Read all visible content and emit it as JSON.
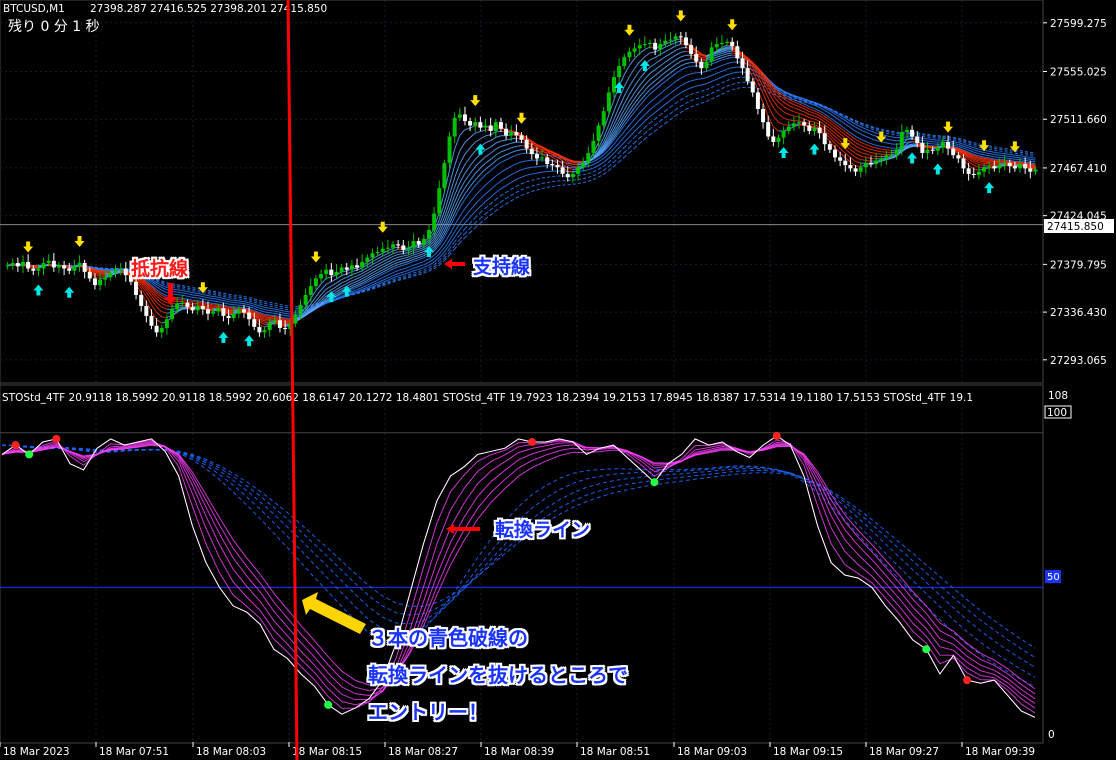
{
  "header": {
    "symbol": "BTCUSD,M1",
    "ohlc": "27398.287 27416.525 27398.201 27415.850",
    "countdown": "残り 0 分 1 秒"
  },
  "indicator": {
    "label": "STOStd_4TF 20.9118 18.5992 20.9118 18.5992 20.6062 18.6147 20.1272 18.4801  STOStd_4TF 19.7923 18.2394 19.2153 17.8945 18.8387 17.5314 19.1180 17.5153  STOStd_4TF 19.1",
    "max_label": "108",
    "top_label": "100",
    "mid_label": "50",
    "bottom_label": "0"
  },
  "annotations": {
    "resistance": "抵抗線",
    "support": "支持線",
    "transition": "転換ライン",
    "entry_line1": "３本の青色破線の",
    "entry_line2": "転換ラインを抜けるところで",
    "entry_line3": "エントリー！"
  },
  "colors": {
    "background": "#000000",
    "bull": "#00c000",
    "bear": "#ffffff",
    "resistance_band": "#ff3000",
    "support_band": "#2a7fff",
    "stoch_fast": "#ff40ff",
    "stoch_slow": "#1a66ff",
    "entry_marker": "#ff0000",
    "arrow_callout": "#ffd400",
    "current_price_bg": "#ffffff"
  },
  "chart_data": [
    {
      "type": "candlestick",
      "title": "BTCUSD,M1",
      "ylim": [
        27272,
        27620
      ],
      "y_ticks": [
        "27599.275",
        "27555.025",
        "27511.660",
        "27467.410",
        "27424.045",
        "27379.795",
        "27336.430",
        "27293.065"
      ],
      "current_price": "27415.850",
      "close": [
        27379,
        27381,
        27378,
        27382,
        27376,
        27374,
        27376,
        27381,
        27383,
        27377,
        27379,
        27376,
        27374,
        27378,
        27381,
        27373,
        27367,
        27361,
        27366,
        27368,
        27372,
        27375,
        27376,
        27370,
        27364,
        27352,
        27342,
        27333,
        27324,
        27318,
        27322,
        27330,
        27339,
        27344,
        27345,
        27341,
        27338,
        27342,
        27339,
        27335,
        27337,
        27340,
        27333,
        27331,
        27335,
        27339,
        27336,
        27330,
        27323,
        27318,
        27320,
        27327,
        27329,
        27322,
        27321,
        27326,
        27334,
        27343,
        27352,
        27360,
        27367,
        27371,
        27375,
        27370,
        27373,
        27377,
        27375,
        27379,
        27377,
        27382,
        27386,
        27390,
        27391,
        27394,
        27395,
        27398,
        27397,
        27393,
        27395,
        27401,
        27398,
        27403,
        27411,
        27426,
        27449,
        27472,
        27496,
        27513,
        27516,
        27510,
        27506,
        27509,
        27504,
        27506,
        27501,
        27509,
        27503,
        27497,
        27500,
        27497,
        27493,
        27485,
        27480,
        27476,
        27477,
        27471,
        27470,
        27468,
        27462,
        27459,
        27462,
        27468,
        27472,
        27481,
        27492,
        27506,
        27519,
        27536,
        27550,
        27560,
        27568,
        27573,
        27576,
        27579,
        27580,
        27581,
        27575,
        27580,
        27583,
        27584,
        27587,
        27586,
        27579,
        27571,
        27564,
        27558,
        27564,
        27577,
        27580,
        27581,
        27582,
        27578,
        27567,
        27558,
        27546,
        27536,
        27521,
        27509,
        27496,
        27491,
        27495,
        27501,
        27505,
        27508,
        27509,
        27506,
        27501,
        27504,
        27499,
        27489,
        27484,
        27477,
        27474,
        27470,
        27467,
        27464,
        27468,
        27472,
        27471,
        27474,
        27476,
        27479,
        27479,
        27484,
        27500,
        27502,
        27496,
        27490,
        27481,
        27484,
        27483,
        27486,
        27491,
        27485,
        27479,
        27476,
        27467,
        27462,
        27461,
        27464,
        27468,
        27469,
        27467,
        27470,
        27472,
        27469,
        27467,
        27471,
        27467,
        27464,
        27466
      ],
      "up_arrows_at_index": [
        6,
        12,
        42,
        47,
        63,
        66,
        82,
        92,
        119,
        124,
        151,
        157,
        176,
        181,
        191
      ],
      "down_arrows_at_index": [
        4,
        14,
        25,
        38,
        60,
        73,
        91,
        100,
        121,
        131,
        141,
        163,
        170,
        183,
        190,
        196
      ]
    },
    {
      "type": "line",
      "title": "STOStd_4TF",
      "ylim": [
        0,
        108
      ],
      "y_ticks": [
        "100",
        "50",
        "0"
      ],
      "fast": [
        93,
        96,
        93,
        97,
        98,
        90,
        88,
        95,
        98,
        96,
        97,
        98,
        94,
        86,
        70,
        58,
        50,
        44,
        42,
        38,
        30,
        27,
        22,
        18,
        12,
        9,
        11,
        14,
        20,
        32,
        48,
        64,
        78,
        86,
        89,
        93,
        94,
        95,
        98,
        97,
        97,
        98,
        97,
        93,
        95,
        96,
        92,
        88,
        84,
        90,
        93,
        98,
        96,
        97,
        94,
        92,
        96,
        99,
        96,
        86,
        70,
        58,
        54,
        53,
        50,
        44,
        39,
        33,
        30,
        22,
        28,
        20,
        19,
        20,
        15,
        10,
        8
      ],
      "slow": [
        96,
        95,
        94,
        94,
        95,
        94,
        93,
        92,
        94,
        95,
        95,
        95,
        94,
        91,
        86,
        81,
        76,
        71,
        66,
        61,
        56,
        51,
        46,
        41,
        37,
        32,
        28,
        25,
        26,
        30,
        37,
        44,
        53,
        61,
        69,
        76,
        81,
        85,
        88,
        90,
        90,
        91,
        91,
        90,
        89,
        89,
        88,
        88,
        88,
        88,
        88,
        89,
        89,
        90,
        90,
        89,
        88,
        86,
        83,
        78,
        72,
        66,
        60,
        55,
        50,
        45,
        41,
        37,
        33,
        29,
        25,
        22,
        20,
        18,
        16,
        14,
        12
      ],
      "green_dots_at_index": [
        2,
        24,
        48,
        68
      ],
      "red_dots_at_index": [
        1,
        4,
        39,
        57,
        71
      ]
    }
  ],
  "time_axis": [
    "18 Mar 2023",
    "18 Mar 07:51",
    "18 Mar 08:03",
    "18 Mar 08:15",
    "18 Mar 08:27",
    "18 Mar 08:39",
    "18 Mar 08:51",
    "18 Mar 09:03",
    "18 Mar 09:15",
    "18 Mar 09:27",
    "18 Mar 09:39"
  ]
}
